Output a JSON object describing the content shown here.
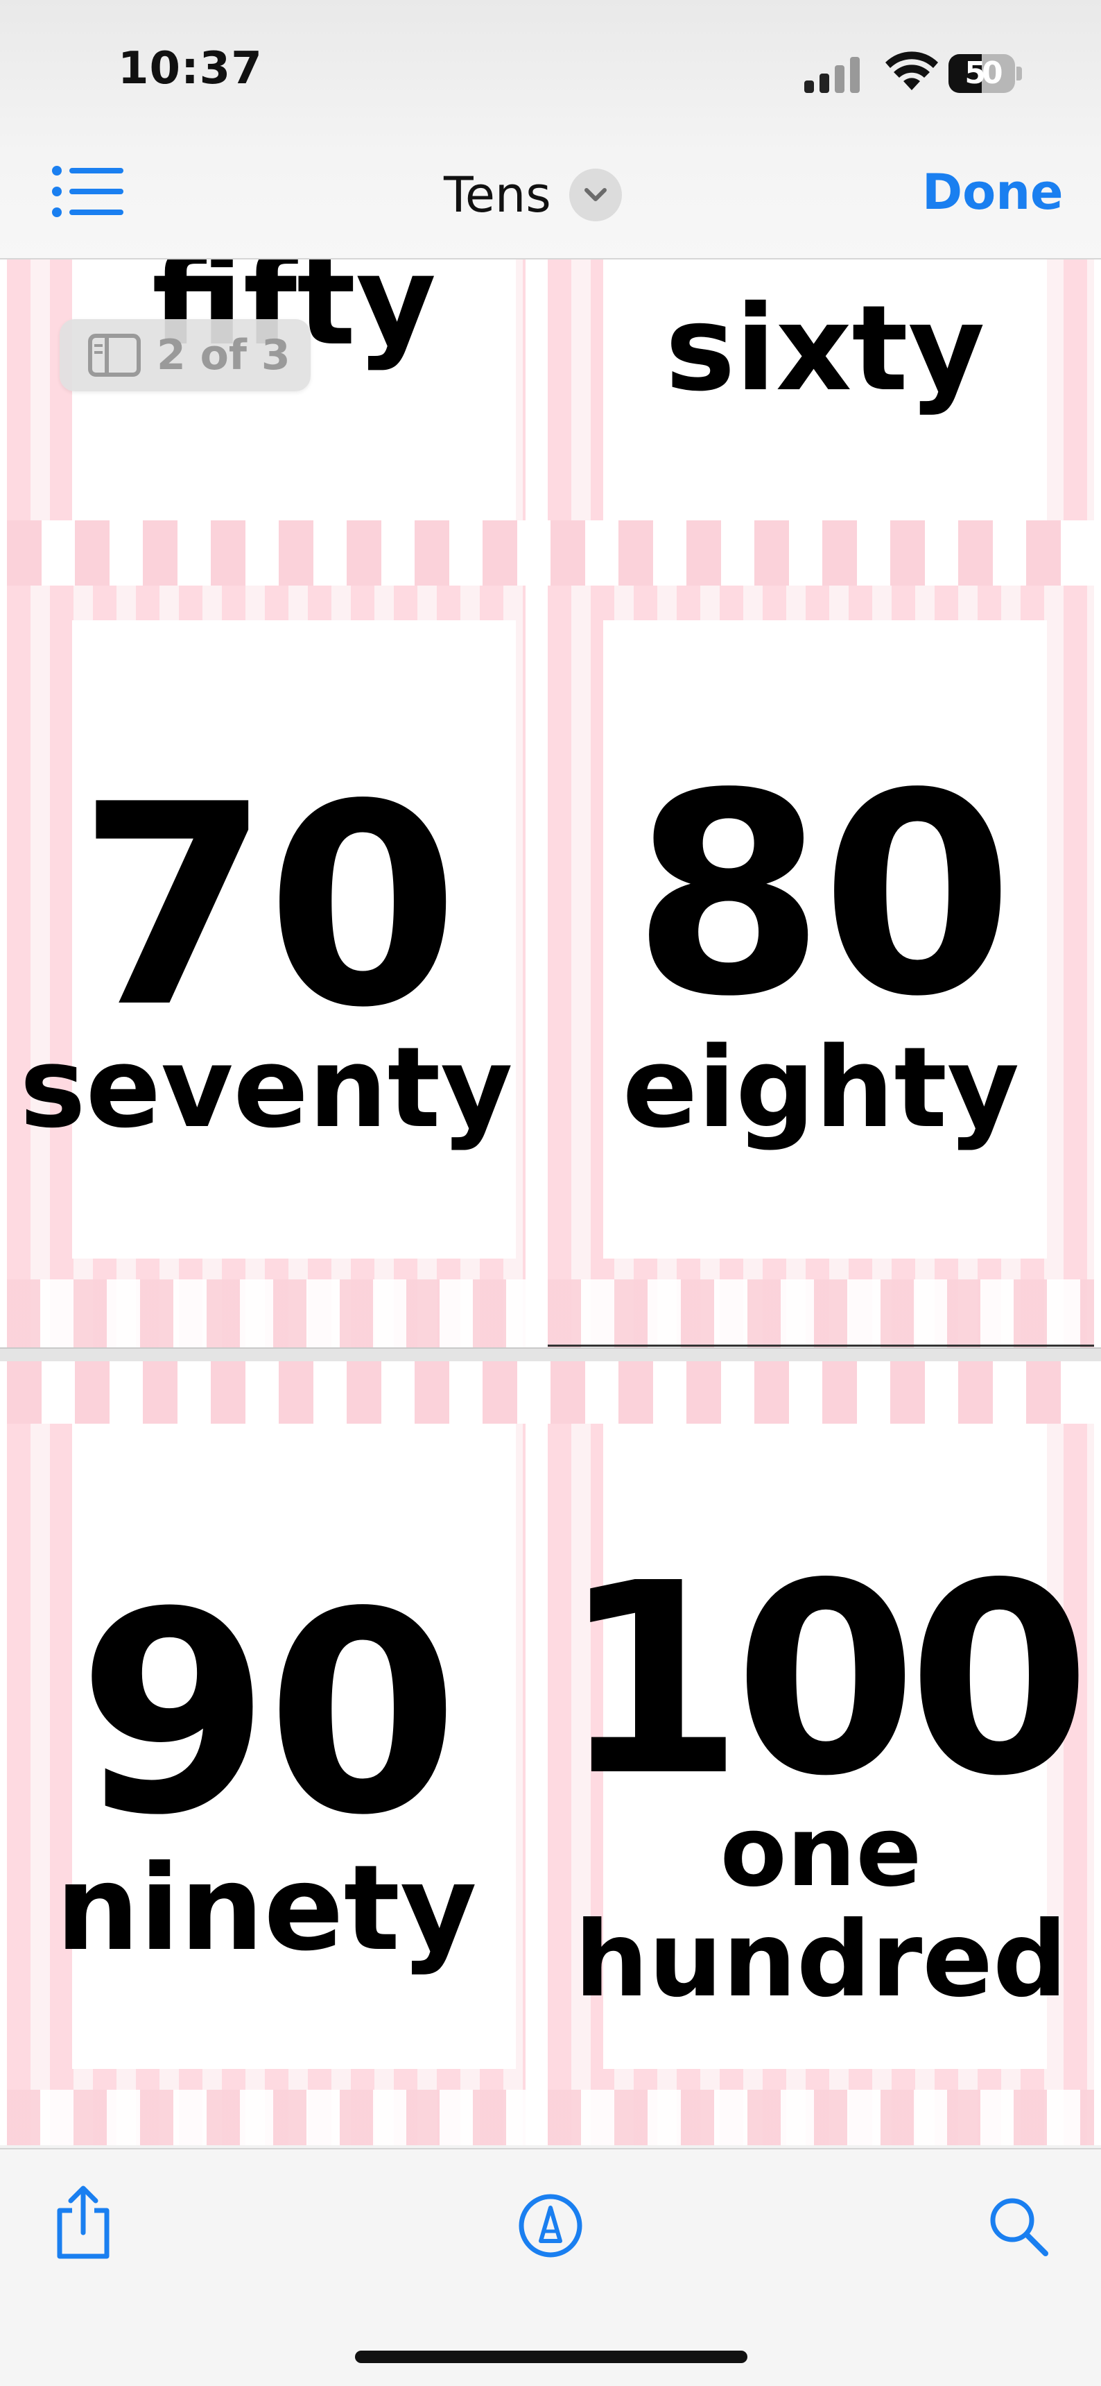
{
  "status_bar": {
    "time": "10:37",
    "battery": "50"
  },
  "nav": {
    "title": "Tens",
    "done_label": "Done"
  },
  "page_indicator": "2 of 3",
  "cards": [
    {
      "number": "",
      "word": "fifty"
    },
    {
      "number": "",
      "word": "sixty"
    },
    {
      "number": "70",
      "word": "seventy"
    },
    {
      "number": "80",
      "word": "eighty"
    },
    {
      "number": "90",
      "word": "ninety"
    },
    {
      "number": "100",
      "word_line1": "one",
      "word_line2": "hundred"
    }
  ],
  "icons": {
    "list": "list-icon",
    "chevron": "chevron-down-icon",
    "share": "share-icon",
    "markup": "markup-pen-icon",
    "search": "search-icon"
  },
  "colors": {
    "accent": "#1a7ff0",
    "card_pink": "#fbd2da"
  }
}
